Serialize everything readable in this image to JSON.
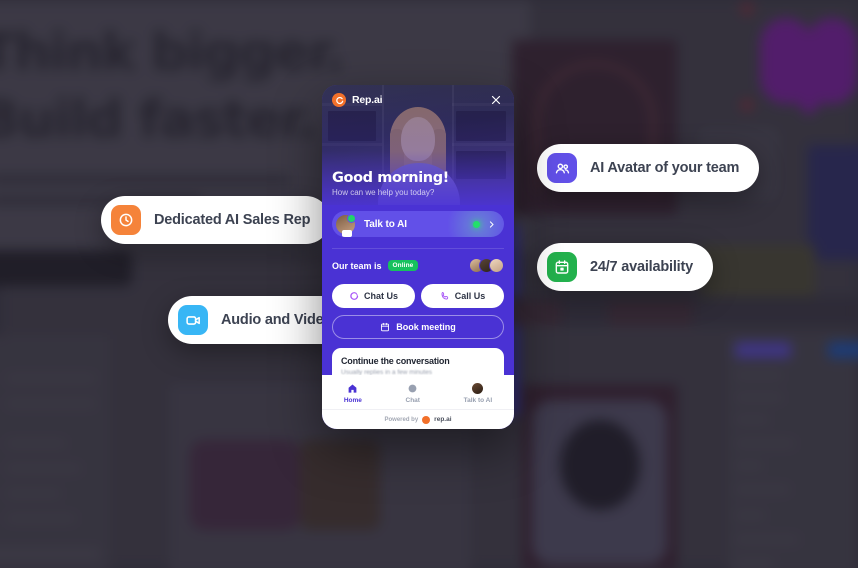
{
  "backdrop": {
    "headline_line1": "Think bigger.",
    "headline_line2": "Build faster."
  },
  "feature_pills": [
    {
      "label": "Dedicated AI Sales Rep",
      "icon": "clock-icon",
      "icon_color": "#f5833a"
    },
    {
      "label": "Audio and Video",
      "icon": "video-camera-icon",
      "icon_color": "#38b6f5"
    },
    {
      "label": "AI Avatar of your team",
      "icon": "users-icon",
      "icon_color": "#6250e8"
    },
    {
      "label": "24/7 availability",
      "icon": "calendar-icon",
      "icon_color": "#23b14d"
    }
  ],
  "widget": {
    "brand_name": "Rep.ai",
    "close_label": "✕",
    "greeting_title": "Good morning!",
    "greeting_subtitle": "How can we help you today?",
    "talk_to_ai": {
      "label": "Talk to AI",
      "chevron": "›"
    },
    "team_status": {
      "text": "Our team is",
      "badge": "Online"
    },
    "actions": {
      "chat_us": "Chat Us",
      "call_us": "Call Us",
      "book_meeting": "Book meeting"
    },
    "conversation": {
      "title": "Continue the conversation",
      "subtitle": "Usually replies in a few minutes"
    },
    "nav": [
      {
        "label": "Home",
        "icon": "home-icon",
        "active": true
      },
      {
        "label": "Chat",
        "icon": "chat-bubble-icon",
        "active": false
      },
      {
        "label": "Talk to AI",
        "icon": "avatar-icon",
        "active": false
      }
    ],
    "footer": {
      "powered_by": "Powered by",
      "brand": "rep.ai"
    }
  },
  "colors": {
    "widget_purple": "#4a32d4",
    "accent_orange": "#f2702a",
    "online_green": "#17c15e"
  }
}
